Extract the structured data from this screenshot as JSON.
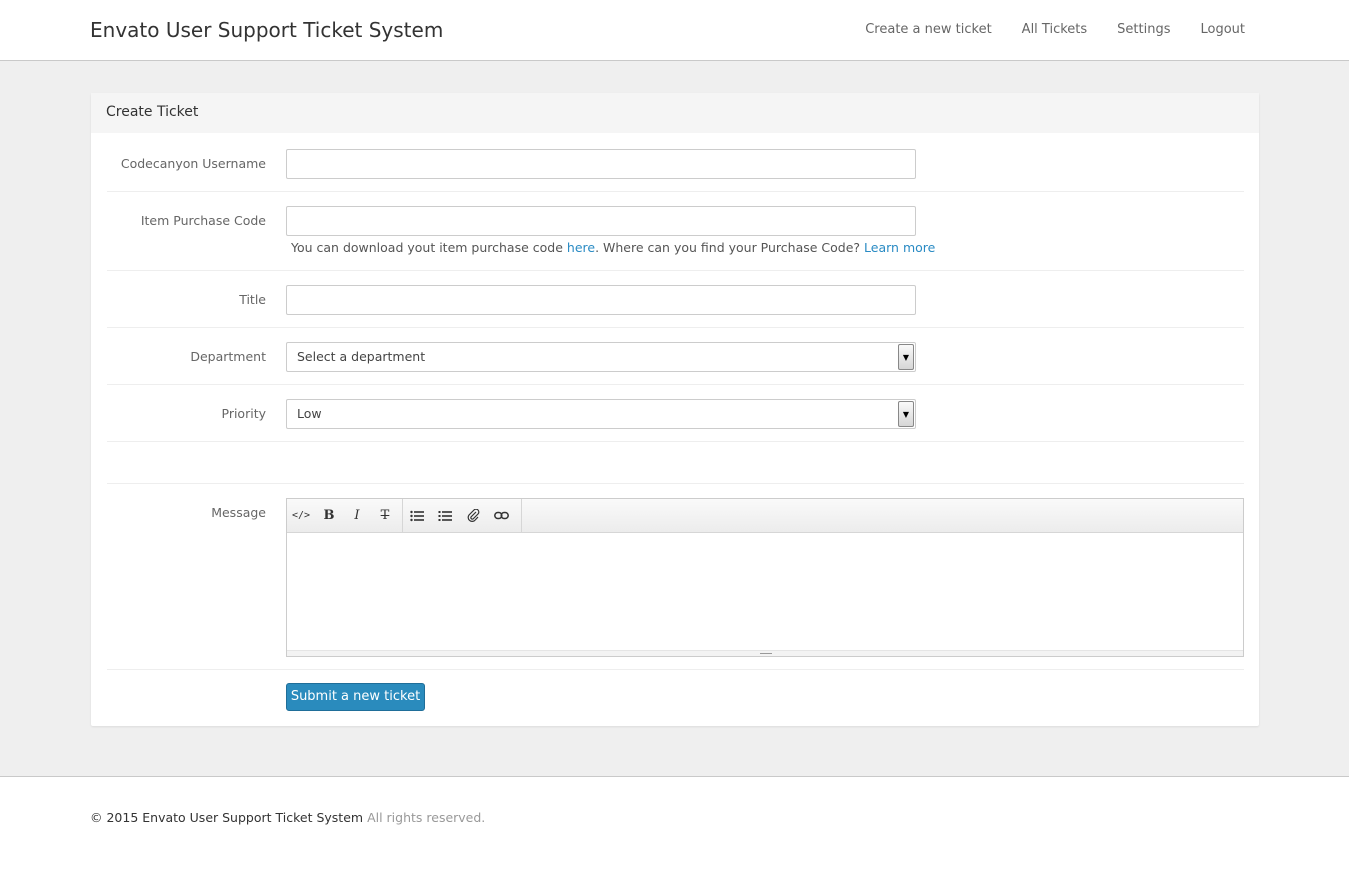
{
  "header": {
    "brand": "Envato User Support Ticket System",
    "nav": [
      "Create a new ticket",
      "All Tickets",
      "Settings",
      "Logout"
    ]
  },
  "panel": {
    "title": "Create Ticket"
  },
  "form": {
    "username_label": "Codecanyon Username",
    "username_value": "",
    "purchase_label": "Item Purchase Code",
    "purchase_value": "",
    "help_prefix": "You can download yout item purchase code ",
    "help_link1": "here",
    "help_middle": ". Where can you find your Purchase Code? ",
    "help_link2": "Learn more",
    "title_label": "Title",
    "title_value": "",
    "department_label": "Department",
    "department_selected": "Select a department",
    "priority_label": "Priority",
    "priority_selected": "Low",
    "message_label": "Message",
    "submit_label": "Submit a new ticket"
  },
  "editor_toolbar": [
    "code-icon",
    "bold-icon",
    "italic-icon",
    "strikethrough-icon",
    "unordered-list-icon",
    "ordered-list-icon",
    "attachment-icon",
    "link-icon"
  ],
  "footer": {
    "copyright": "© 2015 Envato User Support Ticket System",
    "rights": "All rights reserved."
  },
  "colors": {
    "accent": "#2a8bbd",
    "link": "#2a8bc4",
    "background": "#efefef"
  }
}
